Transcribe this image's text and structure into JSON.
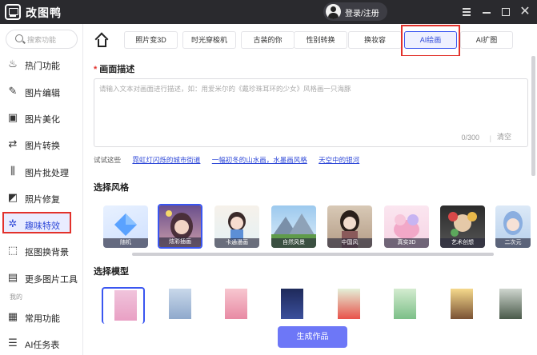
{
  "window": {
    "app_title": "改图鸭",
    "login_label": "登录/注册"
  },
  "sidebar": {
    "search_placeholder": "搜索功能",
    "items": [
      {
        "label": "热门功能",
        "icon": "flame-icon"
      },
      {
        "label": "图片编辑",
        "icon": "image-edit-icon"
      },
      {
        "label": "图片美化",
        "icon": "image-beautify-icon"
      },
      {
        "label": "图片转换",
        "icon": "image-convert-icon"
      },
      {
        "label": "图片批处理",
        "icon": "batch-icon"
      },
      {
        "label": "照片修复",
        "icon": "photo-repair-icon"
      },
      {
        "label": "趣味特效",
        "icon": "magic-wand-icon"
      },
      {
        "label": "抠图换背景",
        "icon": "cutout-icon"
      },
      {
        "label": "更多图片工具",
        "icon": "toolbox-icon"
      }
    ],
    "section_label": "我的",
    "my_items": [
      {
        "label": "常用功能",
        "icon": "grid-icon"
      },
      {
        "label": "AI任务表",
        "icon": "task-list-icon"
      }
    ],
    "active_index": 6
  },
  "tabs": {
    "items": [
      "照片变3D",
      "时光穿梭机",
      "古装的你",
      "性别转换",
      "换妆容",
      "AI绘画",
      "AI扩图"
    ],
    "active": "AI绘画"
  },
  "main": {
    "description_title": "画面描述",
    "prompt_placeholder": "请输入文本对画面进行描述，如：用爱米尔的《戴珍珠耳环的少女》风格画一只海豚",
    "counter": "0/300",
    "clear_label": "清空",
    "try_label": "试试这些",
    "try_links": [
      "霓虹灯闪烁的城市街道",
      "一幅初冬的山水画，水墨画风格",
      "天空中的银河"
    ],
    "style_title": "选择风格",
    "styles": [
      {
        "label": "随机"
      },
      {
        "label": "炫彩插画"
      },
      {
        "label": "卡通漫画"
      },
      {
        "label": "自然风景"
      },
      {
        "label": "中国风"
      },
      {
        "label": "真实3D"
      },
      {
        "label": "艺术创想"
      },
      {
        "label": "二次元"
      }
    ],
    "selected_style": "炫彩插画",
    "model_title": "选择模型",
    "model_count": 8,
    "generate_label": "生成作品"
  },
  "colors": {
    "titlebar": "#2a2a2e",
    "accent": "#3a56f0",
    "generate_button": "#6d77f7",
    "highlight_red": "#e2312b"
  }
}
